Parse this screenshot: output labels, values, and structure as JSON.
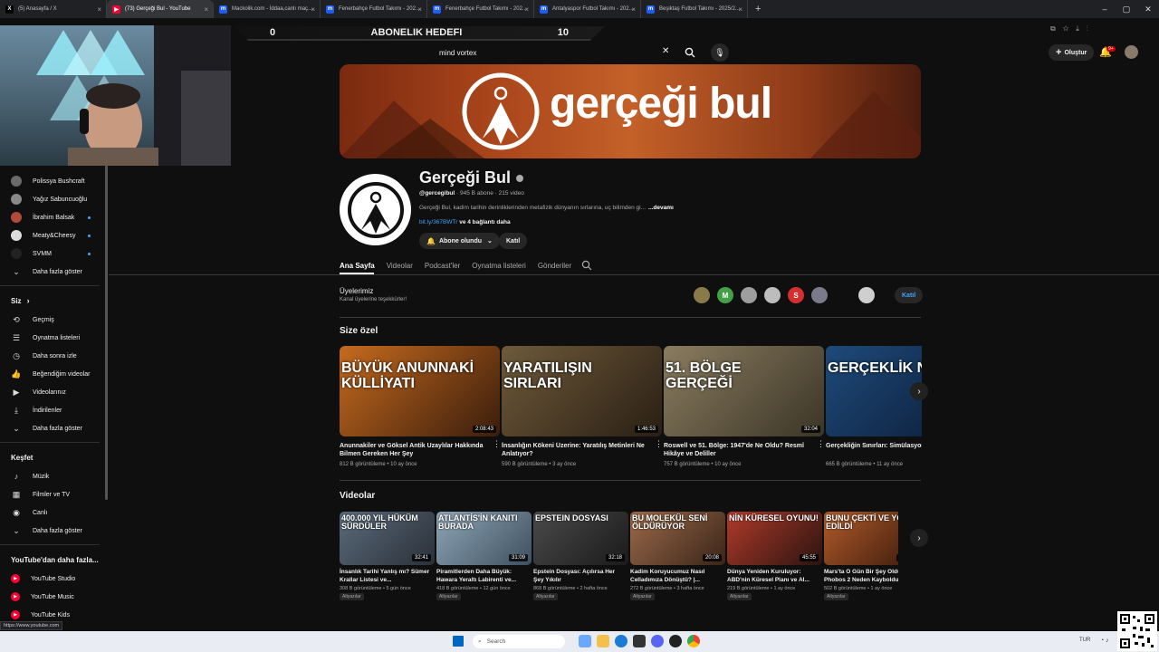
{
  "browser": {
    "tabs": [
      {
        "title": "(5) Anasayfa / X",
        "fav": "X",
        "fav_color": "#000000"
      },
      {
        "title": "(73) Gerçeği Bul - YouTube",
        "fav": "▶",
        "fav_color": "#ff0033",
        "active": true
      },
      {
        "title": "Mackolik.com - İddaa,canlı maç...",
        "fav": "m",
        "fav_color": "#1a5cff"
      },
      {
        "title": "Fenerbahçe Futbol Takımı - 202...",
        "fav": "m",
        "fav_color": "#1a5cff"
      },
      {
        "title": "Fenerbahçe Futbol Takımı - 202...",
        "fav": "m",
        "fav_color": "#1a5cff"
      },
      {
        "title": "Antalyaspor Futbol Takımı - 202...",
        "fav": "m",
        "fav_color": "#1a5cff"
      },
      {
        "title": "Beşiktaş Futbol Takımı - 2025/2...",
        "fav": "m",
        "fav_color": "#1a5cff"
      }
    ],
    "new_tab": "+",
    "status_url": "https://www.youtube.com"
  },
  "overlay": {
    "sub_goal_left": "0",
    "sub_goal_label": "ABONELIK HEDEFI",
    "sub_goal_right": "10"
  },
  "header": {
    "search_value": "mind vortex",
    "create_label": "Oluştur",
    "notif_count": "9+"
  },
  "sidebar": {
    "subscriptions": [
      {
        "label": "Polissya Bushcraft",
        "color": "#6b6b6b",
        "dot": false
      },
      {
        "label": "Yağız Sabuncuoğlu",
        "color": "#8a8a8a",
        "dot": false
      },
      {
        "label": "İbrahim Balsak",
        "color": "#b04a3a",
        "dot": true
      },
      {
        "label": "Meaty&Cheesy",
        "color": "#dddddd",
        "dot": true
      },
      {
        "label": "SVMM",
        "color": "#222222",
        "dot": true
      }
    ],
    "show_more": "Daha fazla göster",
    "you_head": "Siz",
    "you_items": [
      {
        "label": "Geçmiş",
        "icon": "history-icon",
        "glyph": "⟲"
      },
      {
        "label": "Oynatma listeleri",
        "icon": "playlist-icon",
        "glyph": "☰"
      },
      {
        "label": "Daha sonra izle",
        "icon": "clock-icon",
        "glyph": "◷"
      },
      {
        "label": "Beğendiğim videolar",
        "icon": "thumbs-up-icon",
        "glyph": "👍"
      },
      {
        "label": "Videolarınız",
        "icon": "video-icon",
        "glyph": "▶"
      },
      {
        "label": "İndirilenler",
        "icon": "download-icon",
        "glyph": "⤓"
      },
      {
        "label": "Daha fazla göster",
        "icon": "chevron-down-icon",
        "glyph": "⌄"
      }
    ],
    "explore_head": "Keşfet",
    "explore_items": [
      {
        "label": "Müzik",
        "icon": "music-icon",
        "glyph": "♪"
      },
      {
        "label": "Filmler ve TV",
        "icon": "film-icon",
        "glyph": "▦"
      },
      {
        "label": "Canlı",
        "icon": "live-icon",
        "glyph": "◉"
      },
      {
        "label": "Daha fazla göster",
        "icon": "chevron-down-icon",
        "glyph": "⌄"
      }
    ],
    "more_head": "YouTube'dan daha fazla...",
    "more_items": [
      {
        "label": "YouTube Studio"
      },
      {
        "label": "YouTube Music"
      },
      {
        "label": "YouTube Kids"
      }
    ]
  },
  "channel": {
    "banner_text": "gerçeği bul",
    "name": "Gerçeği Bul",
    "handle": "@gercegibul",
    "stats": "· 945 B abone · 215 video",
    "description": "Gerçeği Bul, kadim tarihin derinliklerinden metafizik dünyanın sırlarına, uç bilimden gi...",
    "more": "...devamı",
    "link": "bit.ly/367BWTr",
    "link_more": "ve 4 bağlantı daha",
    "subscribed_label": "Abone olundu",
    "join_label": "Katıl"
  },
  "tabs": [
    "Ana Sayfa",
    "Videolar",
    "Podcast'ler",
    "Oynatma listeleri",
    "Gönderiler"
  ],
  "members": {
    "title": "Üyelerimiz",
    "subtitle": "Kanal üyelerine teşekkürler!",
    "join": "Katıl",
    "avatars": [
      {
        "color": "#8a7a4a",
        "letter": ""
      },
      {
        "color": "#43a047",
        "letter": "M"
      },
      {
        "color": "#9e9e9e",
        "letter": ""
      },
      {
        "color": "#bdbdbd",
        "letter": ""
      },
      {
        "color": "#d32f2f",
        "letter": "S"
      },
      {
        "color": "#7a7a8a",
        "letter": ""
      },
      {
        "color": "#0f0f0f",
        "letter": ""
      },
      {
        "color": "#cfcfcf",
        "letter": ""
      }
    ]
  },
  "for_you": {
    "title": "Size özel",
    "items": [
      {
        "thumb_text": "BÜYÜK ANUNNAKİ KÜLLİYATI",
        "duration": "2:08:43",
        "title": "Anunnakiler ve Göksel Antik Uzaylılar Hakkında Bilmen Gereken Her Şey",
        "meta": "812 B görüntüleme • 10 ay önce",
        "bg": "linear-gradient(135deg,#c56a1e,#3a1d0c)"
      },
      {
        "thumb_text": "YARATILIŞIN SIRLARI",
        "duration": "1:46:53",
        "title": "İnsanlığın Kökeni Üzerine: Yaratılış Metinleri Ne Anlatıyor?",
        "meta": "590 B görüntüleme • 3 ay önce",
        "bg": "linear-gradient(135deg,#6e5a3a,#2a1f14)"
      },
      {
        "thumb_text": "51. BÖLGE GERÇEĞİ",
        "duration": "32:04",
        "title": "Roswell ve 51. Bölge: 1947'de Ne Oldu? Resmî Hikâye ve Deliller",
        "meta": "757 B görüntüleme • 10 ay önce",
        "bg": "linear-gradient(135deg,#8a7c60,#3b3526)"
      },
      {
        "thumb_text": "GERÇEKLİK NEDİR?",
        "duration": "",
        "title": "Gerçekliğin Sınırları: Simülasyon T Kayıtlar",
        "meta": "665 B görüntüleme • 11 ay önce",
        "bg": "linear-gradient(135deg,#1e4a7a,#0b1a33)"
      }
    ]
  },
  "videos": {
    "title": "Videolar",
    "items": [
      {
        "thumb_text": "400.000 YIL HÜKÜM SÜRDÜLER",
        "duration": "32:41",
        "title": "İnsanlık Tarihi Yanlış mı? Sümer Krallar Listesi ve...",
        "meta": "308 B görüntüleme • 5 gün önce",
        "badge": "Altyazılar",
        "bg": "linear-gradient(135deg,#5a6a7a,#2a3038)"
      },
      {
        "thumb_text": "ATLANTİS'İN KANITI BURADA",
        "duration": "31:09",
        "title": "Piramitlerden Daha Büyük: Hawara Yeraltı Labirenti ve...",
        "meta": "418 B görüntüleme • 12 gün önce",
        "badge": "Altyazılar",
        "bg": "linear-gradient(135deg,#8ea5b5,#3d5060)"
      },
      {
        "thumb_text": "EPSTEIN DOSYASI",
        "duration": "32:18",
        "title": "Epstein Dosyası: Açılırsa Her Şey Yıkılır",
        "meta": "868 B görüntüleme • 2 hafta önce",
        "badge": "Altyazılar",
        "bg": "linear-gradient(135deg,#4a4a4a,#1a1a1a)"
      },
      {
        "thumb_text": "BU MOLEKÜL SENİ ÖLDÜRÜYOR",
        "duration": "20:08",
        "title": "Kadim Koruyucumuz Nasıl Celladımıza Dönüştü? |...",
        "meta": "272 B görüntüleme • 3 hafta önce",
        "badge": "Altyazılar",
        "bg": "linear-gradient(135deg,#9a6a4a,#3a2418)"
      },
      {
        "thumb_text": "NİN KÜRESEL OYUNU!",
        "duration": "45:55",
        "title": "Dünya Yeniden Kuruluyor: ABD'nin Küresel Planı ve AI...",
        "meta": "219 B görüntüleme • 1 ay önce",
        "badge": "Altyazılar",
        "bg": "linear-gradient(135deg,#b03a2a,#2a1410)"
      },
      {
        "thumb_text": "BUNU ÇEKTİ VE YOK EDİLDİ",
        "duration": "17:29",
        "title": "Mars'ta O Gün Bir Şey Oldu... Phobos 2 Neden Kayboldu?",
        "meta": "502 B görüntüleme • 1 ay önce",
        "badge": "Altyazılar",
        "bg": "linear-gradient(135deg,#b05a2a,#3a1a0c)"
      }
    ]
  },
  "taskbar": {
    "search_placeholder": "Search",
    "lang": "TUR"
  },
  "colors": {
    "accent_blue": "#3ea6ff",
    "youtube_red": "#ff0033"
  }
}
